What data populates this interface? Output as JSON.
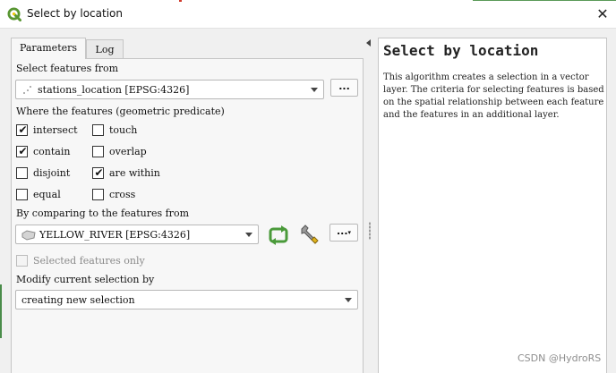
{
  "window": {
    "title": "Select by location",
    "close_glyph": "✕",
    "icon": "qgis-logo-icon"
  },
  "tabs": [
    {
      "label": "Parameters",
      "active": true
    },
    {
      "label": "Log",
      "active": false
    }
  ],
  "params": {
    "select_from_label": "Select features from",
    "select_from_value": "stations_location [EPSG:4326]",
    "predicate_label": "Where the features (geometric predicate)",
    "predicates": [
      {
        "label": "intersect",
        "checked": true
      },
      {
        "label": "touch",
        "checked": false
      },
      {
        "label": "contain",
        "checked": true
      },
      {
        "label": "overlap",
        "checked": false
      },
      {
        "label": "disjoint",
        "checked": false
      },
      {
        "label": "are within",
        "checked": true
      },
      {
        "label": "equal",
        "checked": false
      },
      {
        "label": "cross",
        "checked": false
      }
    ],
    "compare_label": "By comparing to the features from",
    "compare_value": "YELLOW_RIVER [EPSG:4326]",
    "selected_only_label": "Selected features only",
    "selected_only_checked": false,
    "modify_label": "Modify current selection by",
    "modify_value": "creating new selection",
    "dots_label": "...",
    "check_glyph": "✔"
  },
  "help": {
    "title": "Select by location",
    "text": "This algorithm creates a selection in a vector layer. The criteria for selecting features is based on the spatial relationship between each feature and the features in an additional layer."
  },
  "watermark": "CSDN @HydroRS",
  "colors": {
    "accent_green": "#4a9a3a",
    "qgis_green": "#589632",
    "qgis_yellow": "#eec90d"
  }
}
